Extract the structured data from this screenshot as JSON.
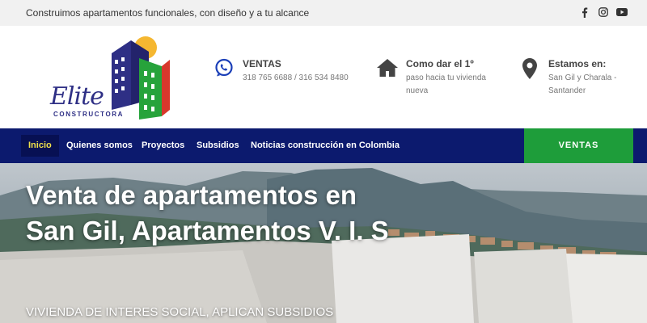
{
  "topbar": {
    "tagline": "Construimos apartamentos funcionales, con diseño y a tu alcance",
    "social": [
      "facebook-icon",
      "instagram-icon",
      "youtube-icon"
    ]
  },
  "logo": {
    "name": "Elite",
    "sub": "CONSTRUCTORA"
  },
  "info": [
    {
      "title": "VENTAS",
      "text": "318 765 6688 / 316 534 8480",
      "icon": "whatsapp-icon"
    },
    {
      "title": "Como dar el 1º",
      "text": "paso hacia tu vivienda nueva",
      "icon": "home-icon"
    },
    {
      "title": "Estamos en:",
      "text": "San Gil y Charala - Santander",
      "icon": "location-pin-icon"
    }
  ],
  "nav": {
    "items": [
      "Inicio",
      "Quienes somos",
      "Proyectos",
      "Subsidios",
      "Noticias construcción en Colombia"
    ],
    "active": "Inicio",
    "cta": "VENTAS"
  },
  "hero": {
    "title": "Venta de apartamentos en San Gil, Apartamentos V. I. S",
    "subtitle": "VIVIENDA DE INTERES SOCIAL, APLICAN SUBSIDIOS"
  },
  "colors": {
    "nav_bg": "#0c1a6e",
    "cta_bg": "#1e9d3a",
    "active_text": "#f0e14a",
    "brand_blue": "#2e2f85"
  }
}
